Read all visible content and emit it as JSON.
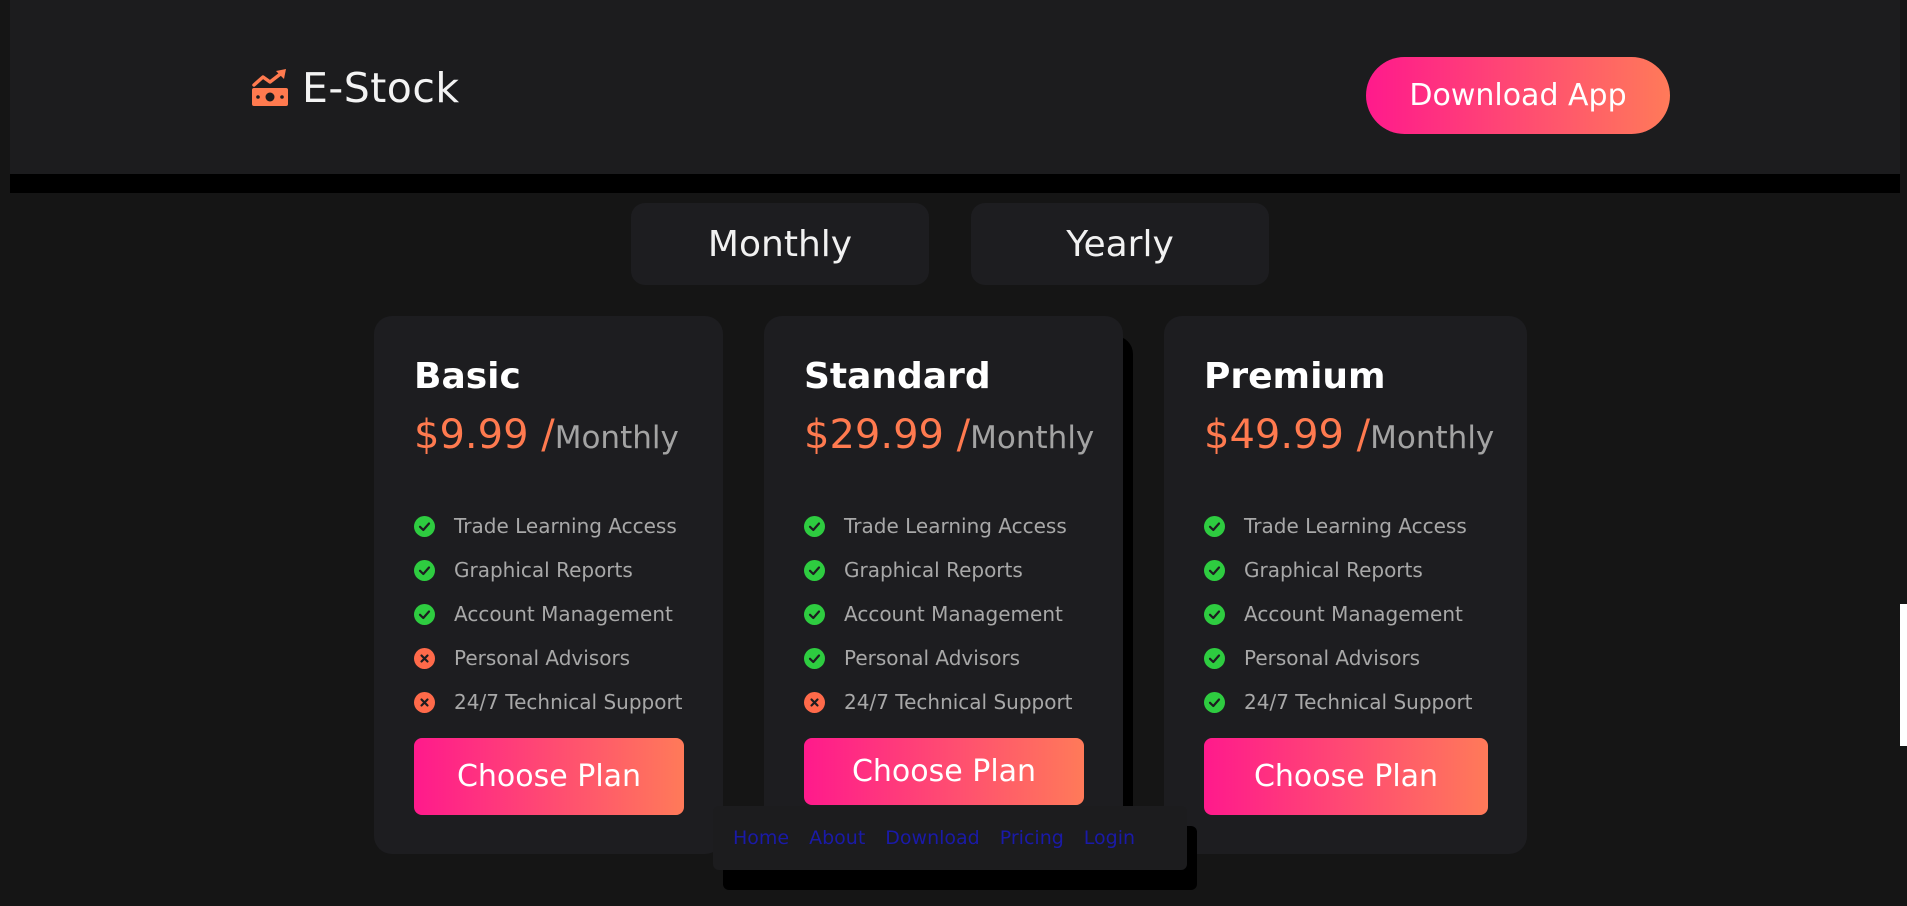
{
  "header": {
    "logo_text": "E-Stock",
    "logo_icon": "money-chart-icon",
    "download_label": "Download App"
  },
  "toggle": {
    "monthly": "Monthly",
    "yearly": "Yearly"
  },
  "plans": [
    {
      "name": "Basic",
      "price": "$9.99 /",
      "period": "Monthly",
      "features": [
        {
          "label": "Trade Learning Access",
          "included": true
        },
        {
          "label": "Graphical Reports",
          "included": true
        },
        {
          "label": "Account Management",
          "included": true
        },
        {
          "label": "Personal Advisors",
          "included": false
        },
        {
          "label": "24/7 Technical Support",
          "included": false
        }
      ],
      "button": "Choose Plan"
    },
    {
      "name": "Standard",
      "price": "$29.99 /",
      "period": "Monthly",
      "features": [
        {
          "label": "Trade Learning Access",
          "included": true
        },
        {
          "label": "Graphical Reports",
          "included": true
        },
        {
          "label": "Account Management",
          "included": true
        },
        {
          "label": "Personal Advisors",
          "included": true
        },
        {
          "label": "24/7 Technical Support",
          "included": false
        }
      ],
      "button": "Choose Plan"
    },
    {
      "name": "Premium",
      "price": "$49.99 /",
      "period": "Monthly",
      "features": [
        {
          "label": "Trade Learning Access",
          "included": true
        },
        {
          "label": "Graphical Reports",
          "included": true
        },
        {
          "label": "Account Management",
          "included": true
        },
        {
          "label": "Personal Advisors",
          "included": true
        },
        {
          "label": "24/7 Technical Support",
          "included": true
        }
      ],
      "button": "Choose Plan"
    }
  ],
  "nav": [
    "Home",
    "About",
    "Download",
    "Pricing",
    "Login"
  ],
  "colors": {
    "accent_start": "#ff1a8c",
    "accent_end": "#ff7a59",
    "price": "#ff7a4f",
    "check": "#2ecc40",
    "cross": "#ff6a4a"
  }
}
